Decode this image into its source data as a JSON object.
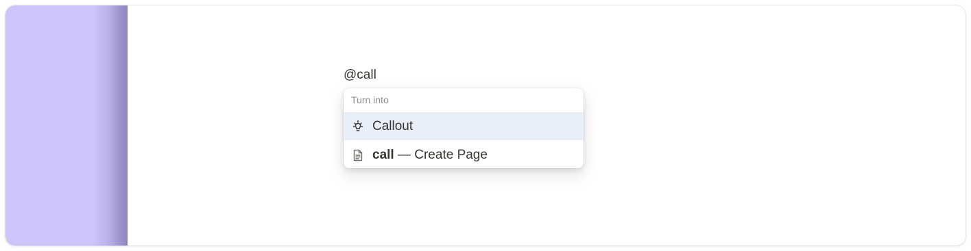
{
  "editor": {
    "typed_text": "@call"
  },
  "menu": {
    "header": "Turn into",
    "items": [
      {
        "icon": "lightbulb-icon",
        "label": "Callout",
        "selected": true
      },
      {
        "icon": "page-icon",
        "query": "call",
        "label": " — Create Page",
        "selected": false
      }
    ]
  },
  "colors": {
    "sidebar": "#ccc5fb",
    "selected_item": "#e9eff9",
    "text": "#37352f",
    "muted_text": "#8e8c88"
  }
}
